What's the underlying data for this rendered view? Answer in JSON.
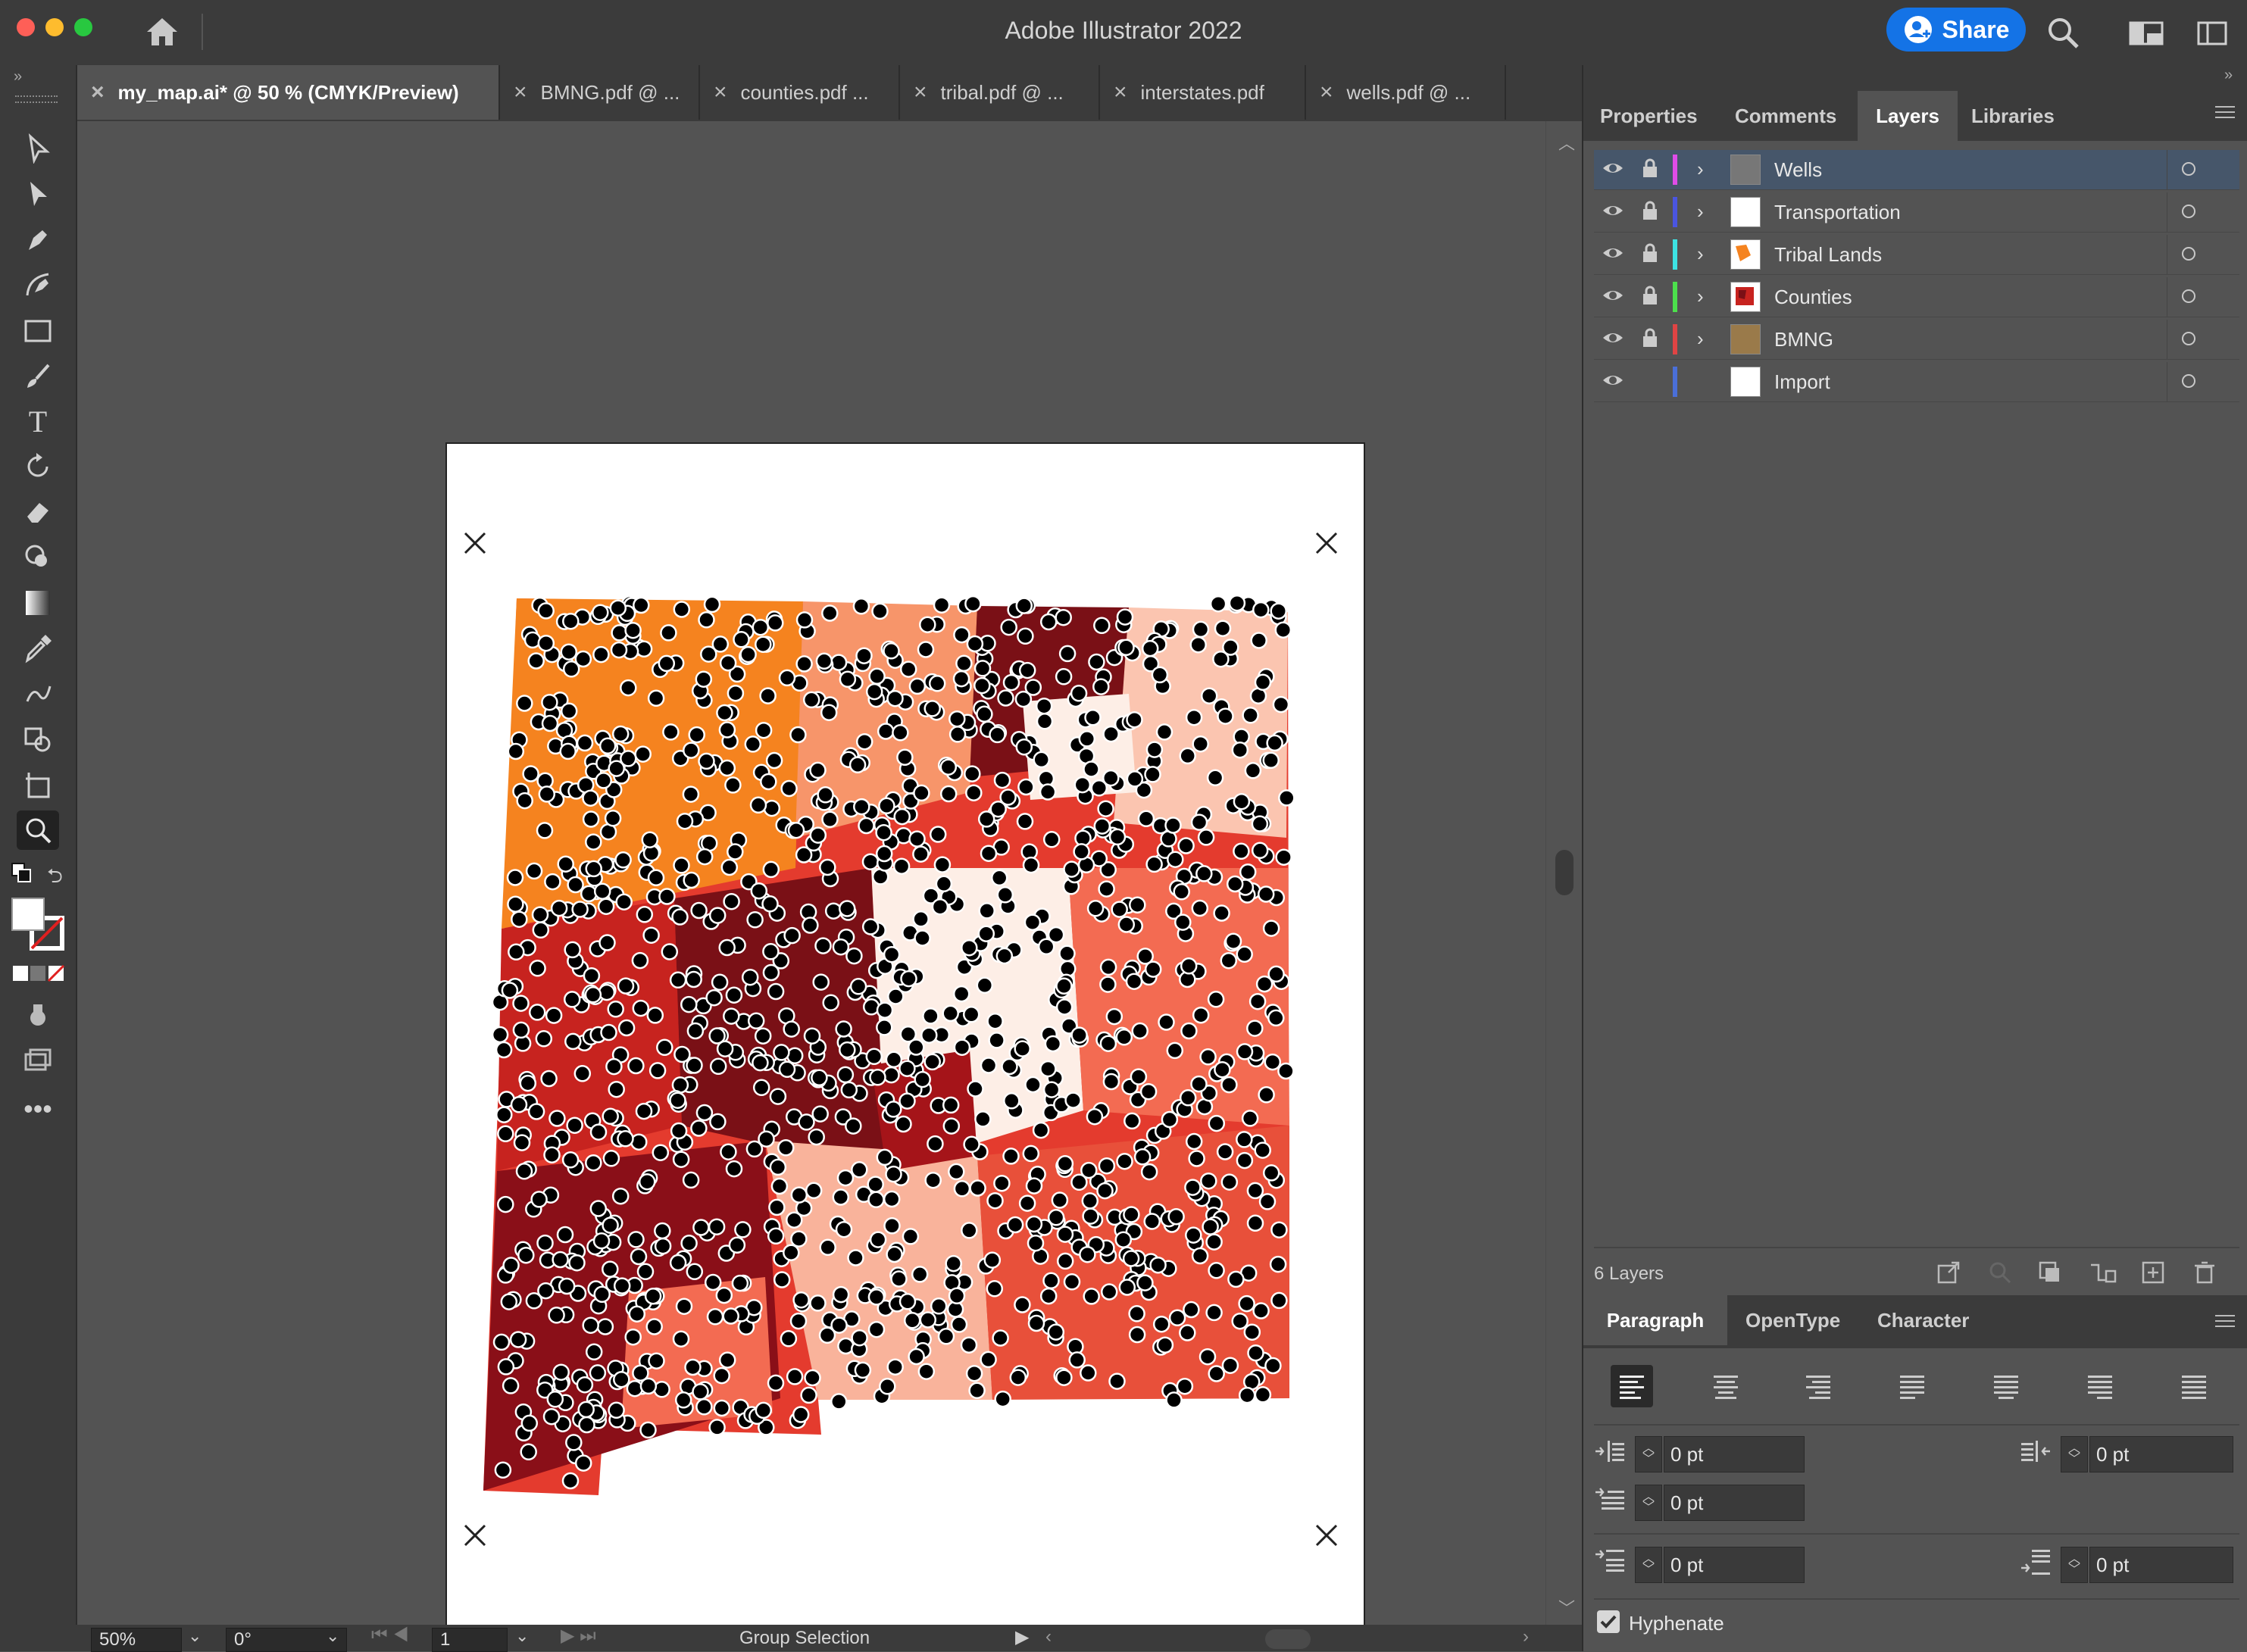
{
  "app": {
    "title": "Adobe Illustrator 2022",
    "share_label": "Share"
  },
  "tabs": [
    {
      "label": "my_map.ai* @ 50 % (CMYK/Preview)"
    },
    {
      "label": "BMNG.pdf @ ..."
    },
    {
      "label": "counties.pdf ..."
    },
    {
      "label": "tribal.pdf @ ..."
    },
    {
      "label": "interstates.pdf"
    },
    {
      "label": "wells.pdf @ ..."
    }
  ],
  "panel_tabs": {
    "properties": "Properties",
    "comments": "Comments",
    "layers": "Layers",
    "libraries": "Libraries"
  },
  "layers": [
    {
      "name": "Wells",
      "color": "#e04ce8"
    },
    {
      "name": "Transportation",
      "color": "#4a55e0"
    },
    {
      "name": "Tribal Lands",
      "color": "#3de3e3"
    },
    {
      "name": "Counties",
      "color": "#4ce04c"
    },
    {
      "name": "BMNG",
      "color": "#e04444"
    },
    {
      "name": "Import",
      "color": "#4a6fd8"
    }
  ],
  "layers_count": "6 Layers",
  "paragraph_tabs": {
    "paragraph": "Paragraph",
    "opentype": "OpenType",
    "character": "Character"
  },
  "paragraph": {
    "left_indent": "0 pt",
    "right_indent": "0 pt",
    "first_line_indent": "0 pt",
    "space_before": "0 pt",
    "space_after": "0 pt",
    "hyphenate_label": "Hyphenate"
  },
  "status": {
    "zoom": "50%",
    "rotation": "0°",
    "artboard": "1",
    "selection_tool": "Group Selection"
  },
  "icons": [
    "home-icon",
    "search-icon",
    "workspace-icon",
    "panel-icon",
    "close-icon",
    "eye-icon",
    "lock-icon",
    "chevron-right-icon"
  ],
  "colors": {
    "accent": "#1473e6"
  }
}
